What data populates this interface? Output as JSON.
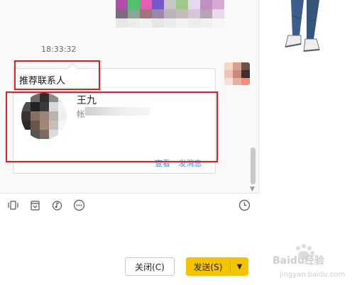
{
  "chat": {
    "timestamp": "18:33:32",
    "card": {
      "title": "推荐联系人",
      "contact_name": "王九",
      "contact_sub": "帐",
      "actions": {
        "view": "查看",
        "message": "发消息"
      }
    }
  },
  "toolbar": {
    "icons": [
      "shake-window-icon",
      "screenshot-icon",
      "music-icon",
      "more-icon"
    ],
    "history_icon": "clock-icon"
  },
  "footer": {
    "close_label": "关闭(C)",
    "send_label": "发送(S)"
  },
  "watermark": {
    "text": "Baidu经验",
    "sub": "jingyan.baidu.com"
  },
  "colors": {
    "send_button": "#f5c400",
    "highlight_box": "#e02020",
    "link": "#3a8ee6"
  }
}
